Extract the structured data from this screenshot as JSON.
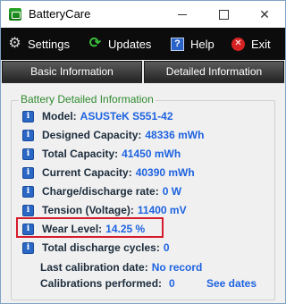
{
  "window": {
    "title": "BatteryCare"
  },
  "toolbar": {
    "settings": "Settings",
    "updates": "Updates",
    "help": "Help",
    "exit": "Exit"
  },
  "tabs": [
    "Basic Information",
    "Detailed Information"
  ],
  "group_title": "Battery Detailed Information",
  "details": [
    {
      "label": "Model:",
      "value": "ASUSTeK S551-42"
    },
    {
      "label": "Designed Capacity:",
      "value": "48336 mWh"
    },
    {
      "label": "Total Capacity:",
      "value": "41450 mWh"
    },
    {
      "label": "Current Capacity:",
      "value": "40390 mWh"
    },
    {
      "label": "Charge/discharge rate:",
      "value": "0 W"
    },
    {
      "label": "Tension (Voltage):",
      "value": "11400 mV"
    },
    {
      "label": "Wear Level:",
      "value": "14.25 %"
    },
    {
      "label": "Total discharge cycles:",
      "value": "0"
    },
    {
      "label": "Last calibration date:",
      "value": "No record"
    },
    {
      "label": "Calibrations performed:",
      "value": "0"
    }
  ],
  "see_dates_link": "See dates",
  "colors": {
    "toolbar_bg": "#0c0c0c",
    "group_title": "#2f8a2f",
    "value_blue": "#1e63e0",
    "highlight_red": "#d61c2c"
  },
  "icons": {
    "settings": "gear-icon",
    "updates": "refresh-icon",
    "help": "help-icon",
    "exit": "exit-icon",
    "detail": "info-icon"
  }
}
